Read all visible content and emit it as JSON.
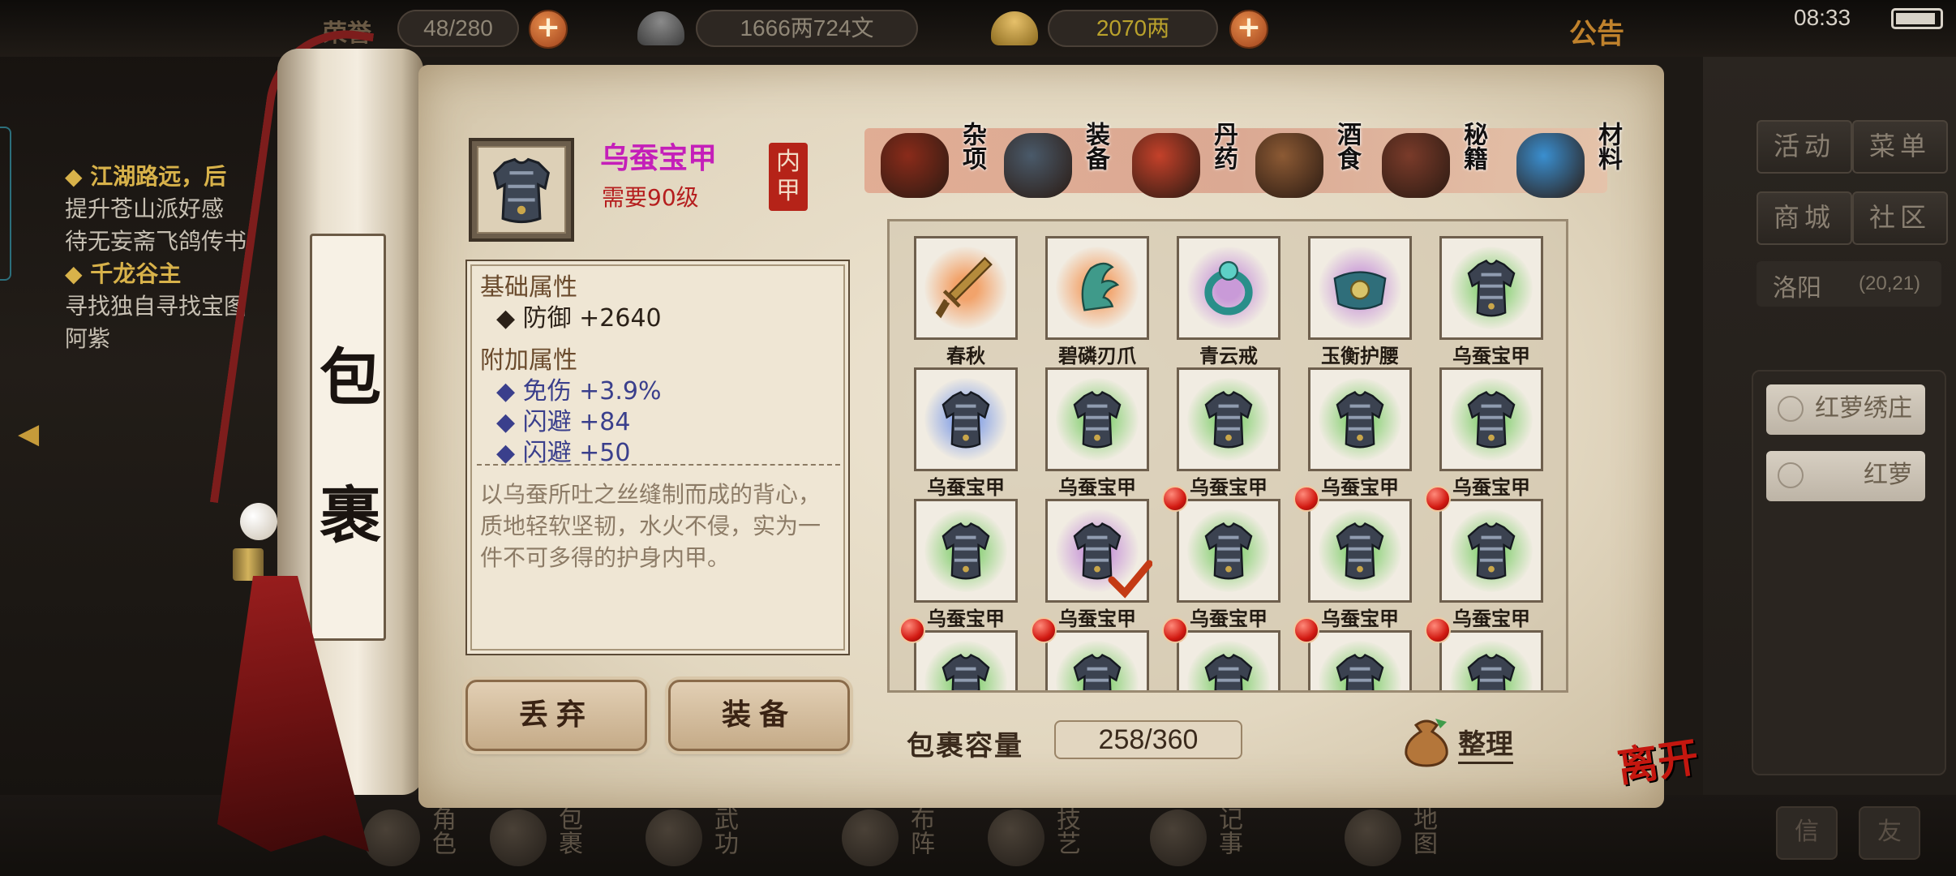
{
  "topbar": {
    "title": "荣誉",
    "stamina": "48/280",
    "silver": "1666两724文",
    "gold": "2070两",
    "announcement": "公告",
    "time": "08:33"
  },
  "quests": [
    {
      "title": "◆ 江湖路远，后",
      "lines": [
        "提升苍山派好感",
        "待无妄斋飞鸽传书"
      ]
    },
    {
      "title": "◆ 千龙谷主",
      "lines": [
        "寻找独自寻找宝图",
        "阿紫"
      ]
    }
  ],
  "right_menu": {
    "buttons": [
      "活动",
      "菜单",
      "商城",
      "社区"
    ],
    "location": "洛阳",
    "coords": "(20,21)",
    "npcs": [
      "红萝绣庄",
      "红萝"
    ],
    "bottom_buttons": [
      "信",
      "友"
    ]
  },
  "bottom_nav": [
    "角色",
    "包裹",
    "武功",
    "布阵",
    "技艺",
    "记事",
    "地图"
  ],
  "scroll": {
    "chars": [
      "包",
      "裹"
    ]
  },
  "item": {
    "name": "乌蚕宝甲",
    "requirement": "需要90级",
    "slot_tag": "内甲",
    "base_header": "基础属性",
    "base_attrs": [
      "◆ 防御  +2640"
    ],
    "extra_header": "附加属性",
    "extra_attrs": [
      "◆ 免伤  +3.9%",
      "◆ 闪避  +84",
      "◆ 闪避  +50"
    ],
    "description": "以乌蚕所吐之丝缝制而成的背心，质地轻软坚韧，水火不侵，实为一件不可多得的护身内甲。"
  },
  "actions": {
    "discard": "丢弃",
    "equip": "装备"
  },
  "tabs": [
    {
      "label": "杂项",
      "color": "#8a2b1a"
    },
    {
      "label": "装备",
      "color": "#4a5a6a"
    },
    {
      "label": "丹药",
      "color": "#c4412a"
    },
    {
      "label": "酒食",
      "color": "#8c5a34"
    },
    {
      "label": "秘籍",
      "color": "#7a3b2a"
    },
    {
      "label": "材料",
      "color": "#3a8fd0"
    }
  ],
  "grid_items": [
    {
      "name": "春秋",
      "icon": "sword-icon",
      "glow": "#f2a36b",
      "dot": false,
      "check": false
    },
    {
      "name": "碧磷刃爪",
      "icon": "claw-icon",
      "glow": "#f2a36b",
      "dot": false,
      "check": false
    },
    {
      "name": "青云戒",
      "icon": "ring-icon",
      "glow": "#c99ad8",
      "dot": false,
      "check": false
    },
    {
      "name": "玉衡护腰",
      "icon": "belt-icon",
      "glow": "#c99ad8",
      "dot": false,
      "check": false
    },
    {
      "name": "乌蚕宝甲",
      "icon": "armor-icon",
      "glow": "#8fd27c",
      "dot": false,
      "check": false
    },
    {
      "name": "乌蚕宝甲",
      "icon": "armor-icon",
      "glow": "#8ca6e6",
      "dot": false,
      "check": false
    },
    {
      "name": "乌蚕宝甲",
      "icon": "armor-icon",
      "glow": "#8fd27c",
      "dot": false,
      "check": false
    },
    {
      "name": "乌蚕宝甲",
      "icon": "armor-icon",
      "glow": "#8fd27c",
      "dot": false,
      "check": false
    },
    {
      "name": "乌蚕宝甲",
      "icon": "armor-icon",
      "glow": "#8fd27c",
      "dot": false,
      "check": false
    },
    {
      "name": "乌蚕宝甲",
      "icon": "armor-icon",
      "glow": "#8fd27c",
      "dot": false,
      "check": false
    },
    {
      "name": "乌蚕宝甲",
      "icon": "armor-icon",
      "glow": "#8fd27c",
      "dot": false,
      "check": false
    },
    {
      "name": "乌蚕宝甲",
      "icon": "armor-icon",
      "glow": "#c99ad8",
      "dot": false,
      "check": true
    },
    {
      "name": "乌蚕宝甲",
      "icon": "armor-icon",
      "glow": "#8fd27c",
      "dot": true,
      "check": false
    },
    {
      "name": "乌蚕宝甲",
      "icon": "armor-icon",
      "glow": "#8fd27c",
      "dot": true,
      "check": false
    },
    {
      "name": "乌蚕宝甲",
      "icon": "armor-icon",
      "glow": "#8fd27c",
      "dot": true,
      "check": false
    },
    {
      "name": "",
      "icon": "armor-icon",
      "glow": "#8fd27c",
      "dot": true,
      "check": false
    },
    {
      "name": "",
      "icon": "armor-icon",
      "glow": "#8fd27c",
      "dot": true,
      "check": false
    },
    {
      "name": "",
      "icon": "armor-icon",
      "glow": "#8fd27c",
      "dot": true,
      "check": false
    },
    {
      "name": "",
      "icon": "armor-icon",
      "glow": "#8fd27c",
      "dot": true,
      "check": false
    },
    {
      "name": "",
      "icon": "armor-icon",
      "glow": "#8fd27c",
      "dot": true,
      "check": false
    }
  ],
  "capacity": {
    "label": "包裹容量",
    "value": "258/360"
  },
  "sort_label": "整理",
  "leave_label": "离开"
}
